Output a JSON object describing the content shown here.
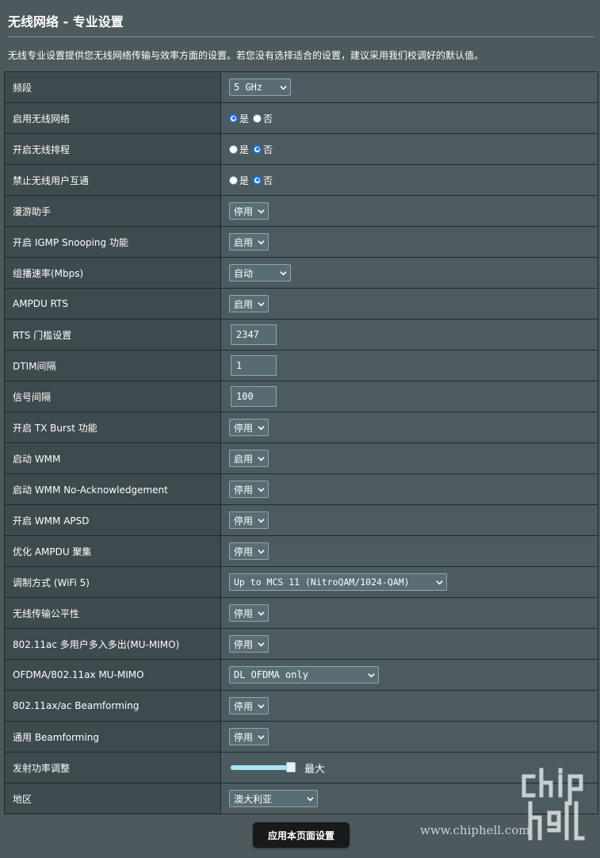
{
  "page": {
    "title": "无线网络 - 专业设置",
    "description": "无线专业设置提供您无线网络传输与效率方面的设置。若您没有选择适合的设置，建议采用我们校调好的默认值。"
  },
  "radio_options": {
    "yes": "是",
    "no": "否"
  },
  "rows": {
    "band": {
      "label": "频段",
      "value": "5 GHz"
    },
    "enable_wireless": {
      "label": "启用无线网络",
      "selected": "是"
    },
    "enable_schedule": {
      "label": "开启无线排程",
      "selected": "否"
    },
    "isolation": {
      "label": "禁止无线用户互通",
      "selected": "否"
    },
    "roaming": {
      "label": "漫游助手",
      "value": "停用"
    },
    "igmp": {
      "label": "开启 IGMP Snooping 功能",
      "value": "启用"
    },
    "multicast_rate": {
      "label": "组播速率(Mbps)",
      "value": "自动"
    },
    "ampdu_rts": {
      "label": "AMPDU RTS",
      "value": "启用"
    },
    "rts_threshold": {
      "label": "RTS 门槛设置",
      "value": "2347"
    },
    "dtim": {
      "label": "DTIM间隔",
      "value": "1"
    },
    "beacon": {
      "label": "信号间隔",
      "value": "100"
    },
    "tx_burst": {
      "label": "开启 TX Burst 功能",
      "value": "停用"
    },
    "wmm": {
      "label": "启动 WMM",
      "value": "启用"
    },
    "wmm_noack": {
      "label": "启动 WMM No-Acknowledgement",
      "value": "停用"
    },
    "wmm_apsd": {
      "label": "开启 WMM APSD",
      "value": "停用"
    },
    "ampdu_agg": {
      "label": "优化 AMPDU 聚集",
      "value": "停用"
    },
    "modulation": {
      "label": "调制方式 (WiFi 5)",
      "value": "Up to MCS 11 (NitroQAM/1024-QAM)"
    },
    "airtime": {
      "label": "无线传输公平性",
      "value": "停用"
    },
    "mu_mimo": {
      "label": "802.11ac 多用户多入多出(MU-MIMO)",
      "value": "停用"
    },
    "ofdma": {
      "label": "OFDMA/802.11ax MU-MIMO",
      "value": "DL OFDMA only"
    },
    "beamforming_ax": {
      "label": "802.11ax/ac Beamforming",
      "value": "停用"
    },
    "beamforming_univ": {
      "label": "通用 Beamforming",
      "value": "停用"
    },
    "tx_power": {
      "label": "发射功率调整",
      "value_text": "最大",
      "level": 1.0
    },
    "region": {
      "label": "地区",
      "value": "澳大利亚"
    }
  },
  "apply_button": "应用本页面设置",
  "watermark": "www.chiphell.com",
  "colors": {
    "accent": "#1a73e8",
    "background": "#4d595d",
    "label_bg": "#3d4a4e"
  }
}
